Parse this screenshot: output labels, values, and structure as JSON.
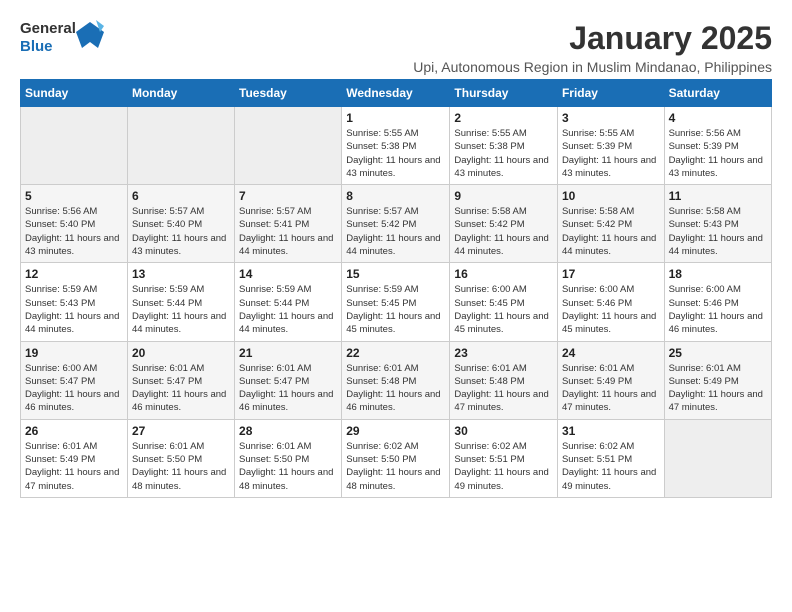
{
  "logo": {
    "line1": "General",
    "line2": "Blue"
  },
  "title": "January 2025",
  "subtitle": "Upi, Autonomous Region in Muslim Mindanao, Philippines",
  "days_of_week": [
    "Sunday",
    "Monday",
    "Tuesday",
    "Wednesday",
    "Thursday",
    "Friday",
    "Saturday"
  ],
  "weeks": [
    [
      {
        "day": null,
        "info": null
      },
      {
        "day": null,
        "info": null
      },
      {
        "day": null,
        "info": null
      },
      {
        "day": "1",
        "sunrise": "5:55 AM",
        "sunset": "5:38 PM",
        "daylight": "11 hours and 43 minutes."
      },
      {
        "day": "2",
        "sunrise": "5:55 AM",
        "sunset": "5:38 PM",
        "daylight": "11 hours and 43 minutes."
      },
      {
        "day": "3",
        "sunrise": "5:55 AM",
        "sunset": "5:39 PM",
        "daylight": "11 hours and 43 minutes."
      },
      {
        "day": "4",
        "sunrise": "5:56 AM",
        "sunset": "5:39 PM",
        "daylight": "11 hours and 43 minutes."
      }
    ],
    [
      {
        "day": "5",
        "sunrise": "5:56 AM",
        "sunset": "5:40 PM",
        "daylight": "11 hours and 43 minutes."
      },
      {
        "day": "6",
        "sunrise": "5:57 AM",
        "sunset": "5:40 PM",
        "daylight": "11 hours and 43 minutes."
      },
      {
        "day": "7",
        "sunrise": "5:57 AM",
        "sunset": "5:41 PM",
        "daylight": "11 hours and 44 minutes."
      },
      {
        "day": "8",
        "sunrise": "5:57 AM",
        "sunset": "5:42 PM",
        "daylight": "11 hours and 44 minutes."
      },
      {
        "day": "9",
        "sunrise": "5:58 AM",
        "sunset": "5:42 PM",
        "daylight": "11 hours and 44 minutes."
      },
      {
        "day": "10",
        "sunrise": "5:58 AM",
        "sunset": "5:42 PM",
        "daylight": "11 hours and 44 minutes."
      },
      {
        "day": "11",
        "sunrise": "5:58 AM",
        "sunset": "5:43 PM",
        "daylight": "11 hours and 44 minutes."
      }
    ],
    [
      {
        "day": "12",
        "sunrise": "5:59 AM",
        "sunset": "5:43 PM",
        "daylight": "11 hours and 44 minutes."
      },
      {
        "day": "13",
        "sunrise": "5:59 AM",
        "sunset": "5:44 PM",
        "daylight": "11 hours and 44 minutes."
      },
      {
        "day": "14",
        "sunrise": "5:59 AM",
        "sunset": "5:44 PM",
        "daylight": "11 hours and 44 minutes."
      },
      {
        "day": "15",
        "sunrise": "5:59 AM",
        "sunset": "5:45 PM",
        "daylight": "11 hours and 45 minutes."
      },
      {
        "day": "16",
        "sunrise": "6:00 AM",
        "sunset": "5:45 PM",
        "daylight": "11 hours and 45 minutes."
      },
      {
        "day": "17",
        "sunrise": "6:00 AM",
        "sunset": "5:46 PM",
        "daylight": "11 hours and 45 minutes."
      },
      {
        "day": "18",
        "sunrise": "6:00 AM",
        "sunset": "5:46 PM",
        "daylight": "11 hours and 46 minutes."
      }
    ],
    [
      {
        "day": "19",
        "sunrise": "6:00 AM",
        "sunset": "5:47 PM",
        "daylight": "11 hours and 46 minutes."
      },
      {
        "day": "20",
        "sunrise": "6:01 AM",
        "sunset": "5:47 PM",
        "daylight": "11 hours and 46 minutes."
      },
      {
        "day": "21",
        "sunrise": "6:01 AM",
        "sunset": "5:47 PM",
        "daylight": "11 hours and 46 minutes."
      },
      {
        "day": "22",
        "sunrise": "6:01 AM",
        "sunset": "5:48 PM",
        "daylight": "11 hours and 46 minutes."
      },
      {
        "day": "23",
        "sunrise": "6:01 AM",
        "sunset": "5:48 PM",
        "daylight": "11 hours and 47 minutes."
      },
      {
        "day": "24",
        "sunrise": "6:01 AM",
        "sunset": "5:49 PM",
        "daylight": "11 hours and 47 minutes."
      },
      {
        "day": "25",
        "sunrise": "6:01 AM",
        "sunset": "5:49 PM",
        "daylight": "11 hours and 47 minutes."
      }
    ],
    [
      {
        "day": "26",
        "sunrise": "6:01 AM",
        "sunset": "5:49 PM",
        "daylight": "11 hours and 47 minutes."
      },
      {
        "day": "27",
        "sunrise": "6:01 AM",
        "sunset": "5:50 PM",
        "daylight": "11 hours and 48 minutes."
      },
      {
        "day": "28",
        "sunrise": "6:01 AM",
        "sunset": "5:50 PM",
        "daylight": "11 hours and 48 minutes."
      },
      {
        "day": "29",
        "sunrise": "6:02 AM",
        "sunset": "5:50 PM",
        "daylight": "11 hours and 48 minutes."
      },
      {
        "day": "30",
        "sunrise": "6:02 AM",
        "sunset": "5:51 PM",
        "daylight": "11 hours and 49 minutes."
      },
      {
        "day": "31",
        "sunrise": "6:02 AM",
        "sunset": "5:51 PM",
        "daylight": "11 hours and 49 minutes."
      },
      {
        "day": null,
        "info": null
      }
    ]
  ]
}
